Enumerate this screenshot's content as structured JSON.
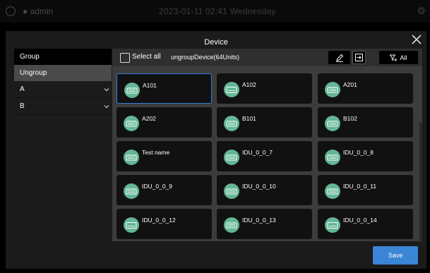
{
  "status_bar": {
    "user": "admin",
    "datetime": "2023-01-11 02:41 Wednesday"
  },
  "dialog": {
    "title": "Device"
  },
  "sidebar": {
    "items": [
      {
        "label": "Group"
      },
      {
        "label": "Ungroup"
      },
      {
        "label": "A"
      },
      {
        "label": "B"
      }
    ]
  },
  "toolbar": {
    "select_all_label": "Select all",
    "group_name": "ungroupDevice(64Units)",
    "filter_label": "All"
  },
  "devices": [
    {
      "name": "A101",
      "icon": "cassette-unit-icon"
    },
    {
      "name": "A102",
      "icon": "wall-unit-icon"
    },
    {
      "name": "A201",
      "icon": "cassette-unit-icon"
    },
    {
      "name": "A202",
      "icon": "cassette-unit-icon"
    },
    {
      "name": "B101",
      "icon": "cassette-unit-icon"
    },
    {
      "name": "B102",
      "icon": "cassette-unit-icon"
    },
    {
      "name": "Test name",
      "icon": "cassette-unit-icon"
    },
    {
      "name": "IDU_0_0_7",
      "icon": "cassette-unit-icon"
    },
    {
      "name": "IDU_0_0_8",
      "icon": "cassette-unit-icon"
    },
    {
      "name": "IDU_0_0_9",
      "icon": "cassette-unit-icon"
    },
    {
      "name": "IDU_0_0_10",
      "icon": "cassette-unit-icon"
    },
    {
      "name": "IDU_0_0_11",
      "icon": "cassette-unit-icon"
    },
    {
      "name": "IDU_0_0_12",
      "icon": "wall-unit-icon"
    },
    {
      "name": "IDU_0_0_13",
      "icon": "cassette-unit-icon"
    },
    {
      "name": "IDU_0_0_14",
      "icon": "wall-unit-icon"
    }
  ],
  "footer": {
    "save_label": "Save"
  },
  "colors": {
    "accent": "#3a85d6",
    "icon_bg": "#63b696",
    "selected_border": "#2f7fd6"
  }
}
